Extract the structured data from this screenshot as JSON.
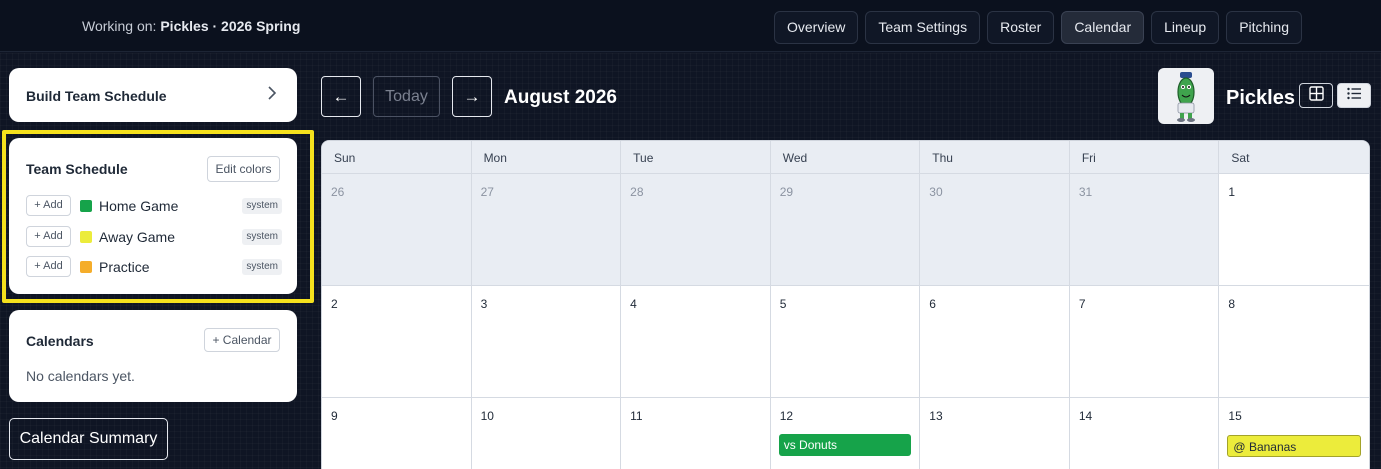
{
  "header": {
    "working_prefix": "Working on: ",
    "working_team": "Pickles · 2026 Spring",
    "tabs": [
      {
        "label": "Overview",
        "active": false
      },
      {
        "label": "Team Settings",
        "active": false
      },
      {
        "label": "Roster",
        "active": false
      },
      {
        "label": "Calendar",
        "active": true
      },
      {
        "label": "Lineup",
        "active": false
      },
      {
        "label": "Pitching",
        "active": false
      }
    ]
  },
  "sidebar": {
    "build": {
      "label": "Build Team Schedule",
      "icon": "chevron-right-icon"
    },
    "team_schedule": {
      "title": "Team Schedule",
      "edit_colors": "Edit colors",
      "types": [
        {
          "add": "+ Add",
          "label": "Home Game",
          "color": "#16a34a",
          "badge": "system"
        },
        {
          "add": "+ Add",
          "label": "Away Game",
          "color": "#ecec3b",
          "badge": "system"
        },
        {
          "add": "+ Add",
          "label": "Practice",
          "color": "#f5ad2a",
          "badge": "system"
        }
      ]
    },
    "calendars": {
      "title": "Calendars",
      "add": "+ Calendar",
      "empty": "No calendars yet."
    },
    "summary": "Calendar Summary"
  },
  "toolbar": {
    "prev": "←",
    "today": "Today",
    "next": "→",
    "month": "August 2026",
    "team": "Pickles"
  },
  "calendar": {
    "weekdays": [
      "Sun",
      "Mon",
      "Tue",
      "Wed",
      "Thu",
      "Fri",
      "Sat"
    ],
    "weeks": [
      [
        {
          "d": "26",
          "out": true
        },
        {
          "d": "27",
          "out": true
        },
        {
          "d": "28",
          "out": true
        },
        {
          "d": "29",
          "out": true
        },
        {
          "d": "30",
          "out": true
        },
        {
          "d": "31",
          "out": true
        },
        {
          "d": "1"
        }
      ],
      [
        {
          "d": "2"
        },
        {
          "d": "3"
        },
        {
          "d": "4"
        },
        {
          "d": "5"
        },
        {
          "d": "6"
        },
        {
          "d": "7"
        },
        {
          "d": "8"
        }
      ],
      [
        {
          "d": "9"
        },
        {
          "d": "10"
        },
        {
          "d": "11"
        },
        {
          "d": "12",
          "event": {
            "label": "vs Donuts",
            "kind": "home"
          }
        },
        {
          "d": "13"
        },
        {
          "d": "14"
        },
        {
          "d": "15",
          "event": {
            "label": "@ Bananas",
            "kind": "away"
          }
        }
      ]
    ]
  }
}
